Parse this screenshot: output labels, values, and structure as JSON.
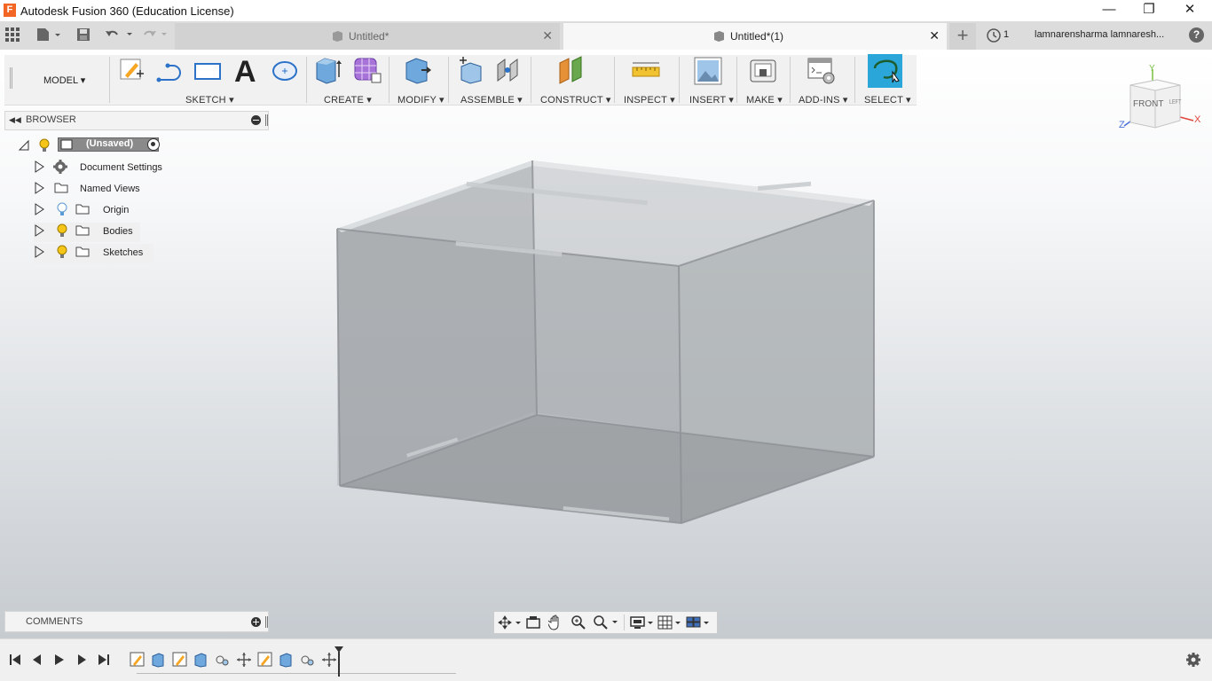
{
  "titlebar": {
    "logo_letter": "F",
    "title": "Autodesk Fusion 360 (Education License)",
    "minimize": "—",
    "restore": "❐",
    "close": "✕"
  },
  "tabs": [
    {
      "label": "Untitled*",
      "close": "✕",
      "active": false
    },
    {
      "label": "Untitled*(1)",
      "close": "✕",
      "active": true
    }
  ],
  "topbar": {
    "new_tab": "+",
    "job_count": "1",
    "user": "lamnarensharma lamnaresh...",
    "help": "?"
  },
  "toolbar": {
    "workspace": "MODEL ▾",
    "groups": [
      {
        "label": "SKETCH ▾"
      },
      {
        "label": "CREATE ▾"
      },
      {
        "label": "MODIFY ▾"
      },
      {
        "label": "ASSEMBLE ▾"
      },
      {
        "label": "CONSTRUCT ▾"
      },
      {
        "label": "INSPECT ▾"
      },
      {
        "label": "INSERT ▾"
      },
      {
        "label": "MAKE ▾"
      },
      {
        "label": "ADD-INS ▾"
      },
      {
        "label": "SELECT ▾"
      }
    ]
  },
  "browser": {
    "title": "BROWSER",
    "root": "(Unsaved)",
    "items": [
      {
        "label": "Document Settings",
        "icon": "gear-icon"
      },
      {
        "label": "Named Views",
        "icon": "folder-icon"
      },
      {
        "label": "Origin",
        "icon": "folder-icon"
      },
      {
        "label": "Bodies",
        "icon": "folder-icon"
      },
      {
        "label": "Sketches",
        "icon": "folder-icon"
      }
    ]
  },
  "comments": {
    "title": "COMMENTS"
  },
  "viewcube": {
    "front": "FRONT",
    "left": "LEFT",
    "x": "X",
    "y": "Y",
    "z": "Z"
  },
  "colors": {
    "accent": "#0696d7",
    "select_active": "#2aa7d8",
    "lightbulb_on": "#f5c518",
    "lightbulb_off": "#5b9bd5"
  }
}
